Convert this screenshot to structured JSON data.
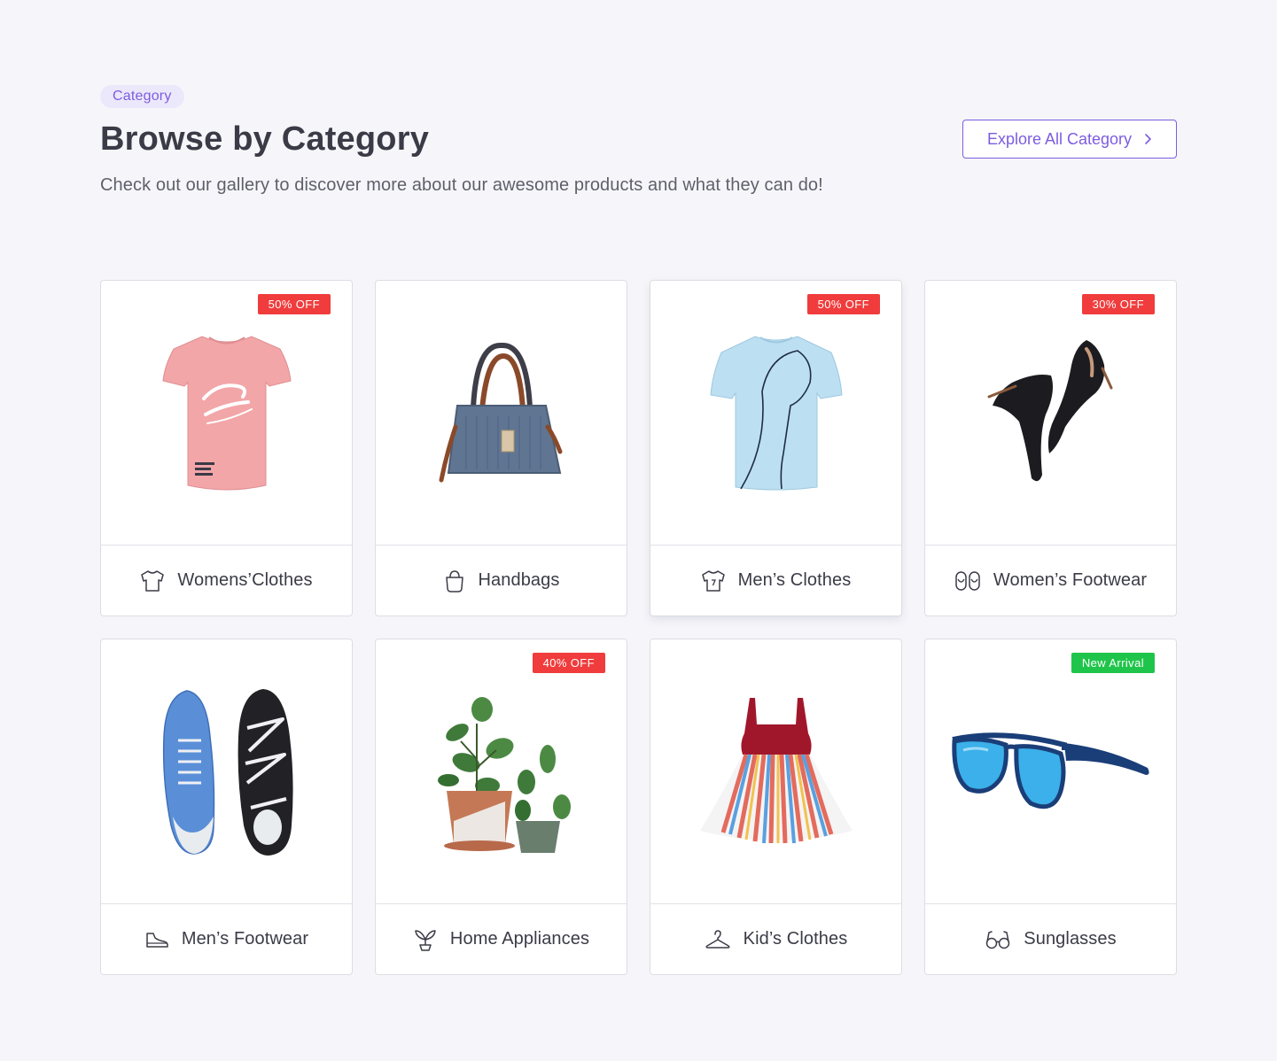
{
  "header": {
    "eyebrow": "Category",
    "title": "Browse by Category",
    "subtitle": "Check out our gallery to discover more about our awesome products and what they can do!",
    "explore_label": "Explore All Category"
  },
  "colors": {
    "accent": "#7c5ce0",
    "sale_badge": "#f03c3c",
    "new_badge": "#1fc54a",
    "background": "#f6f6fa"
  },
  "categories": [
    {
      "label": "Womens’Clothes",
      "badge": "50% OFF",
      "icon": "tshirt-icon",
      "image": "pink-tshirt"
    },
    {
      "label": "Handbags",
      "badge": "",
      "icon": "bag-icon",
      "image": "blue-handbag"
    },
    {
      "label": "Men’s Clothes",
      "badge": "50% OFF",
      "icon": "tshirt-icon",
      "image": "light-blue-tshirt"
    },
    {
      "label": "Women’s Footwear",
      "badge": "30% OFF",
      "icon": "footprints-icon",
      "image": "black-heels"
    },
    {
      "label": "Men’s Footwear",
      "badge": "",
      "icon": "sneaker-icon",
      "image": "blue-sneakers"
    },
    {
      "label": "Home Appliances",
      "badge": "40% OFF",
      "icon": "sprout-icon",
      "image": "potted-plants"
    },
    {
      "label": "Kid’s Clothes",
      "badge": "",
      "icon": "hanger-icon",
      "image": "striped-dress"
    },
    {
      "label": "Sunglasses",
      "badge": "New Arrival",
      "icon": "glasses-icon",
      "image": "blue-sunglasses"
    }
  ]
}
